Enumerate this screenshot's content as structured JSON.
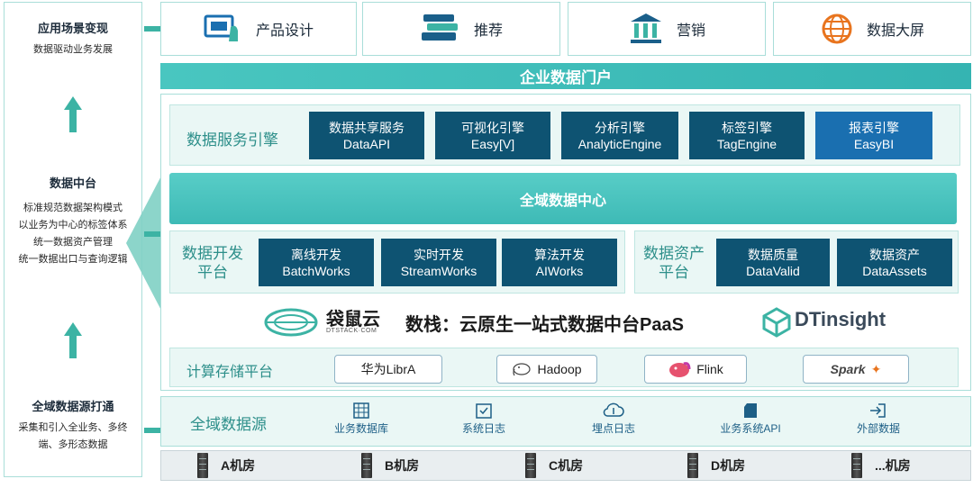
{
  "left": {
    "app": {
      "title": "应用场景变现",
      "desc": "数据驱动业务发展"
    },
    "middle": {
      "title": "数据中台",
      "lines": [
        "标准规范数据架构模式",
        "以业务为中心的标签体系",
        "统一数据资产管理",
        "统一数据出口与查询逻辑"
      ]
    },
    "source": {
      "title": "全域数据源打通",
      "lines": [
        "采集和引入全业务、多终",
        "端、多形态数据"
      ]
    }
  },
  "apps": [
    {
      "label": "产品设计",
      "icon": "basket-hand-icon"
    },
    {
      "label": "推荐",
      "icon": "books-icon"
    },
    {
      "label": "营销",
      "icon": "bank-icon"
    },
    {
      "label": "数据大屏",
      "icon": "globe-icon"
    }
  ],
  "portal": "企业数据门户",
  "services": {
    "title": "数据服务引擎",
    "items": [
      {
        "name": "数据共享服务",
        "sub": "DataAPI"
      },
      {
        "name": "可视化引擎",
        "sub": "Easy[V]"
      },
      {
        "name": "分析引擎",
        "sub": "AnalyticEngine"
      },
      {
        "name": "标签引擎",
        "sub": "TagEngine"
      },
      {
        "name": "报表引擎",
        "sub": "EasyBI"
      }
    ]
  },
  "center": "全域数据中心",
  "dev": {
    "title_lines": [
      "数据开发",
      "平台"
    ],
    "items": [
      {
        "name": "离线开发",
        "sub": "BatchWorks"
      },
      {
        "name": "实时开发",
        "sub": "StreamWorks"
      },
      {
        "name": "算法开发",
        "sub": "AIWorks"
      }
    ]
  },
  "assets": {
    "title_lines": [
      "数据资产",
      "平台"
    ],
    "items": [
      {
        "name": "数据质量",
        "sub": "DataValid"
      },
      {
        "name": "数据资产",
        "sub": "DataAssets"
      }
    ]
  },
  "brand": {
    "logo_cn": "袋鼠云",
    "logo_en": "DTSTACK·COM",
    "slogan": "数栈：云原生一站式数据中台PaaS",
    "partner": "DTinsight"
  },
  "storage": {
    "title": "计算存储平台",
    "items": [
      "华为LibrA",
      "Hadoop",
      "Flink",
      "Spark"
    ]
  },
  "sources": {
    "title": "全域数据源",
    "items": [
      "业务数据库",
      "系统日志",
      "埋点日志",
      "业务系统API",
      "外部数据"
    ]
  },
  "rooms": [
    "A机房",
    "B机房",
    "C机房",
    "D机房",
    "...机房"
  ],
  "colors": {
    "teal": "#3cb3a4",
    "dark_blue": "#0e5372",
    "accent_blue": "#1a6fb0"
  }
}
